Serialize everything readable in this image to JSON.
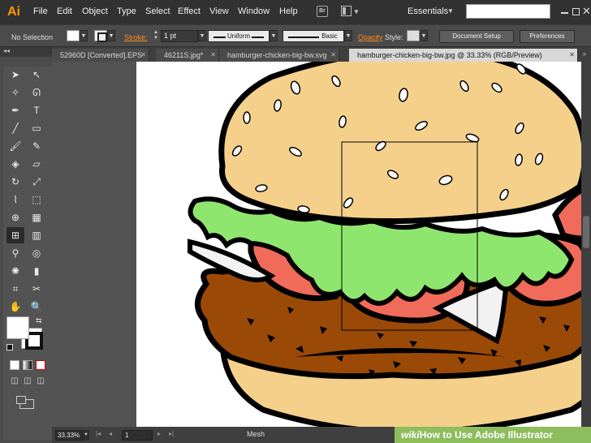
{
  "app": {
    "logo_text": "Ai",
    "menus": [
      "File",
      "Edit",
      "Object",
      "Type",
      "Select",
      "Effect",
      "View",
      "Window",
      "Help"
    ],
    "bridge_label": "Br",
    "workspace": "Essentials"
  },
  "control": {
    "selection": "No Selection",
    "stroke_label": "Stroke:",
    "stroke_weight": "1 pt",
    "variable_width": "Uniform",
    "brush": "Basic",
    "opacity_label": "Opacity",
    "style_label": "Style:",
    "document_setup": "Document Setup",
    "preferences": "Preferences"
  },
  "tabs": [
    "52960D [Converted].EPS",
    "46211S.jpg*",
    "hamburger-chicken-big-bw.svg",
    "hamburger-chicken-big-bw.jpg @ 33.33% (RGB/Preview)"
  ],
  "status": {
    "zoom": "33.33%",
    "page": "1",
    "tool": "Mesh"
  },
  "watermark": {
    "wiki": "wiki",
    "rest": "How to Use Adobe Illustrator"
  },
  "artwork": {
    "bun": "#f4d08b",
    "tomato": "#f06b5a",
    "lettuce": "#8fe66f",
    "patty": "#9a4a06",
    "outline": "#000000"
  }
}
